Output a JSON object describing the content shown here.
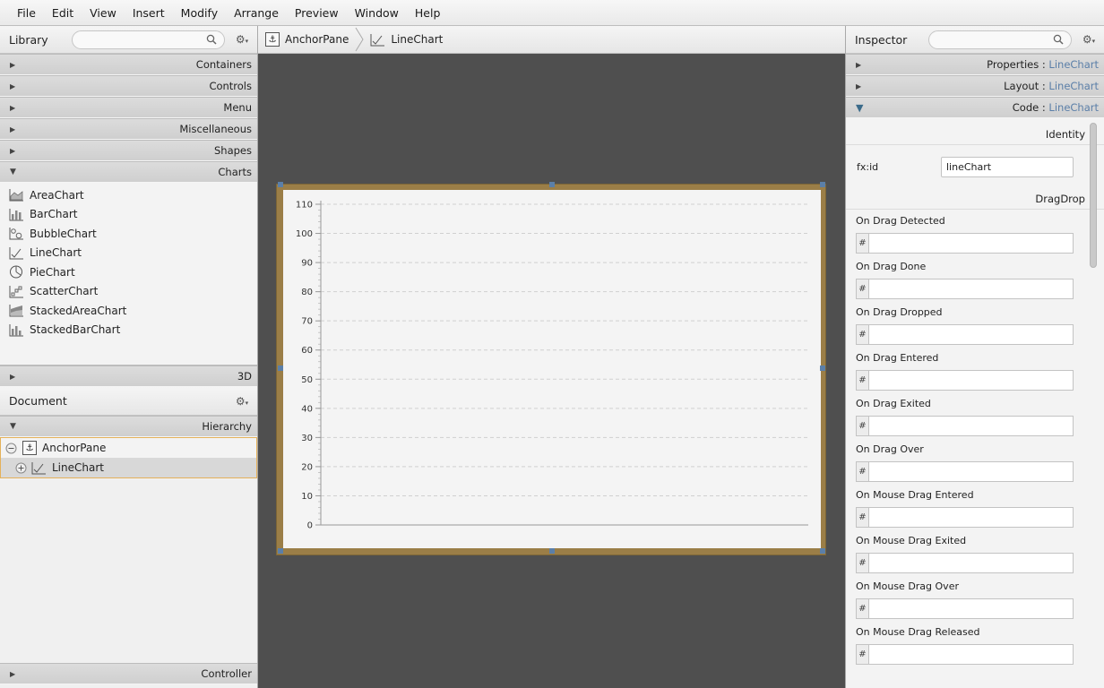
{
  "menu": [
    "File",
    "Edit",
    "View",
    "Insert",
    "Modify",
    "Arrange",
    "Preview",
    "Window",
    "Help"
  ],
  "library": {
    "title": "Library",
    "sections_top": [
      "Containers",
      "Controls",
      "Menu",
      "Miscellaneous",
      "Shapes"
    ],
    "charts_section": "Charts",
    "charts": [
      "AreaChart",
      "BarChart",
      "BubbleChart",
      "LineChart",
      "PieChart",
      "ScatterChart",
      "StackedAreaChart",
      "StackedBarChart"
    ],
    "section_3d": "3D"
  },
  "document": {
    "title": "Document",
    "hierarchy_label": "Hierarchy",
    "tree": [
      "AnchorPane",
      "LineChart"
    ],
    "controller_label": "Controller"
  },
  "breadcrumb": [
    "AnchorPane",
    "LineChart"
  ],
  "chart_data": {
    "type": "line",
    "series": [],
    "yticks": [
      "110",
      "100",
      "90",
      "80",
      "70",
      "60",
      "50",
      "40",
      "30",
      "20",
      "10",
      "0"
    ],
    "ylim": [
      0,
      110
    ],
    "grid": true
  },
  "inspector": {
    "title": "Inspector",
    "sections": [
      {
        "name": "Properties",
        "sep": " : ",
        "target": "LineChart"
      },
      {
        "name": "Layout",
        "sep": " : ",
        "target": "LineChart"
      },
      {
        "name": "Code",
        "sep": " : ",
        "target": "LineChart"
      }
    ],
    "identity_label": "Identity",
    "fxid_label": "fx:id",
    "fxid_value": "lineChart",
    "dragdrop_label": "DragDrop",
    "hash_symbol": "#",
    "events": [
      "On Drag Detected",
      "On Drag Done",
      "On Drag Dropped",
      "On Drag Entered",
      "On Drag Exited",
      "On Drag Over",
      "On Mouse Drag Entered",
      "On Mouse Drag Exited",
      "On Mouse Drag Over",
      "On Mouse Drag Released"
    ]
  }
}
